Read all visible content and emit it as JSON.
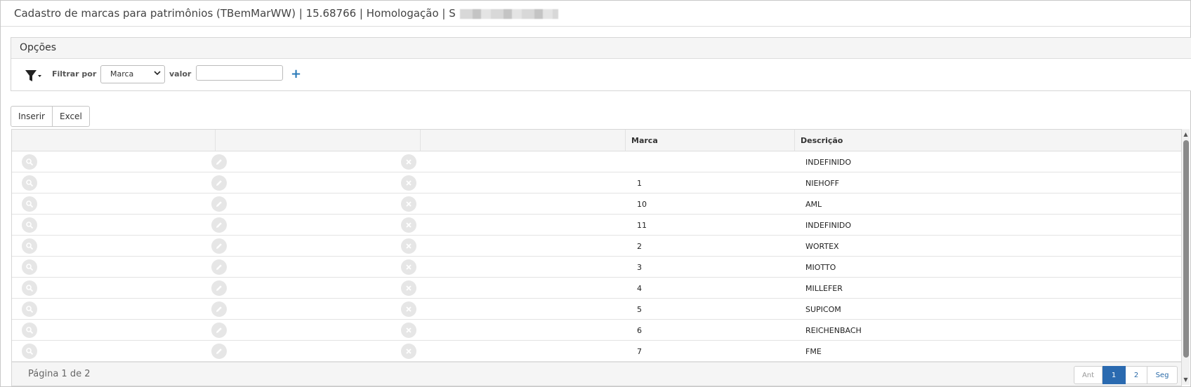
{
  "window": {
    "title": "Cadastro de marcas para patrimônios (TBemMarWW) | 15.68766 | Homologação | S"
  },
  "options": {
    "title": "Opções",
    "filter_icon": "filter-icon",
    "filter_label": "Filtrar por",
    "filter_selected": "Marca",
    "valor_label": "valor",
    "valor_value": "",
    "add_icon": "plus-icon",
    "add_label": "+"
  },
  "toolbar": {
    "insert_label": "Inserir",
    "excel_label": "Excel"
  },
  "grid": {
    "columns": [
      "",
      "",
      "",
      "Marca",
      "Descrição"
    ],
    "rows": [
      {
        "marca": "",
        "descricao": "INDEFINIDO"
      },
      {
        "marca": "1",
        "descricao": "NIEHOFF"
      },
      {
        "marca": "10",
        "descricao": "AML"
      },
      {
        "marca": "11",
        "descricao": "INDEFINIDO"
      },
      {
        "marca": "2",
        "descricao": "WORTEX"
      },
      {
        "marca": "3",
        "descricao": "MIOTTO"
      },
      {
        "marca": "4",
        "descricao": "MILLEFER"
      },
      {
        "marca": "5",
        "descricao": "SUPICOM"
      },
      {
        "marca": "6",
        "descricao": "REICHENBACH"
      },
      {
        "marca": "7",
        "descricao": "FME"
      }
    ],
    "row_icons": [
      "search-icon",
      "edit-icon",
      "delete-icon"
    ]
  },
  "footer": {
    "page_info": "Página 1 de 2",
    "pager": {
      "prev": "Ant",
      "pages": [
        "1",
        "2"
      ],
      "current": "1",
      "next": "Seg"
    }
  },
  "colors": {
    "accent": "#2a6ab0",
    "header_bg": "#f5f5f5",
    "icon_bg": "#e6e6e6"
  }
}
